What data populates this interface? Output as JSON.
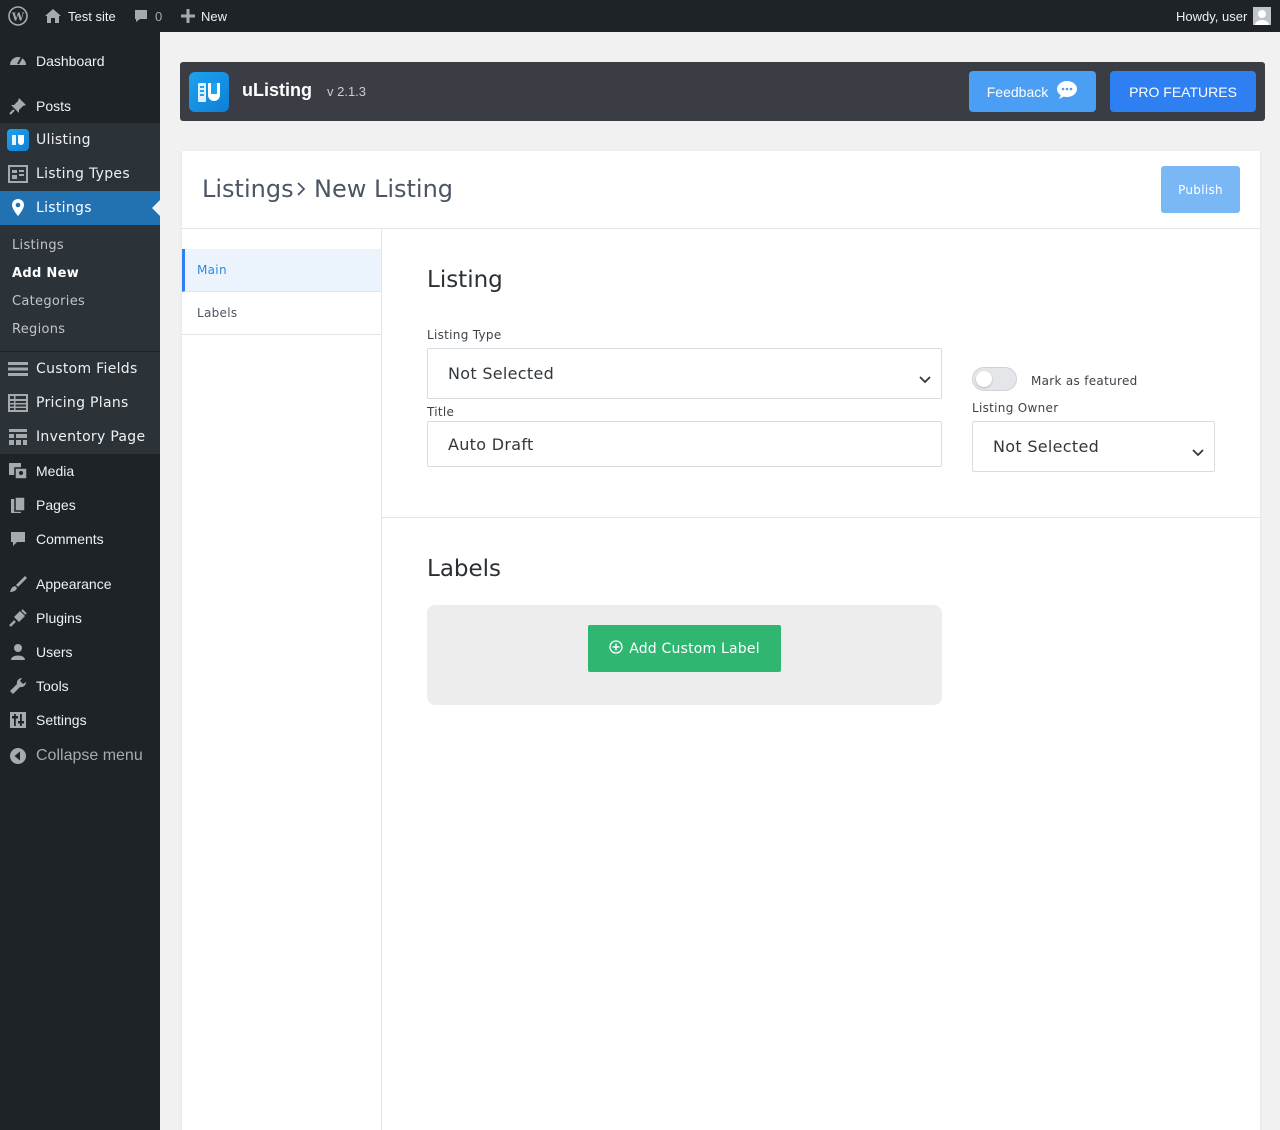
{
  "adminbar": {
    "site_name": "Test site",
    "comments_count": "0",
    "new_label": "New",
    "greeting": "Howdy, user"
  },
  "sidebar": {
    "items": [
      {
        "label": "Dashboard",
        "icon": "dashboard-icon"
      },
      {
        "label": "Posts",
        "icon": "pin-icon"
      },
      {
        "label": "Ulisting",
        "icon": "ulisting-icon"
      },
      {
        "label": "Listing Types",
        "icon": "listing-types-icon"
      },
      {
        "label": "Listings",
        "icon": "location-pin-icon"
      },
      {
        "label": "Custom Fields",
        "icon": "menu-lines-icon"
      },
      {
        "label": "Pricing Plans",
        "icon": "table-icon"
      },
      {
        "label": "Inventory Page",
        "icon": "grid-icon"
      },
      {
        "label": "Media",
        "icon": "media-icon"
      },
      {
        "label": "Pages",
        "icon": "pages-icon"
      },
      {
        "label": "Comments",
        "icon": "comment-icon"
      },
      {
        "label": "Appearance",
        "icon": "brush-icon"
      },
      {
        "label": "Plugins",
        "icon": "plug-icon"
      },
      {
        "label": "Users",
        "icon": "user-icon"
      },
      {
        "label": "Tools",
        "icon": "wrench-icon"
      },
      {
        "label": "Settings",
        "icon": "sliders-icon"
      }
    ],
    "submenu": [
      "Listings",
      "Add New",
      "Categories",
      "Regions"
    ],
    "collapse_label": "Collapse menu"
  },
  "header": {
    "title": "uListing",
    "version": "v 2.1.3",
    "feedback_label": "Feedback",
    "pro_label": "PRO FEATURES"
  },
  "page": {
    "breadcrumb_parent": "Listings",
    "breadcrumb_current": "New Listing",
    "publish_label": "Publish"
  },
  "tabs": [
    "Main",
    "Labels"
  ],
  "listing_section": {
    "title": "Listing",
    "listing_type_label": "Listing Type",
    "listing_type_value": "Not Selected",
    "title_label": "Title",
    "title_value": "Auto Draft",
    "featured_label": "Mark as featured",
    "owner_label": "Listing Owner",
    "owner_value": "Not Selected"
  },
  "labels_section": {
    "title": "Labels",
    "add_label": "Add Custom Label"
  },
  "colors": {
    "wp_dark": "#1d2327",
    "wp_blue": "#2271b1",
    "accent_blue": "#2e7ff2",
    "green": "#2fb771"
  }
}
